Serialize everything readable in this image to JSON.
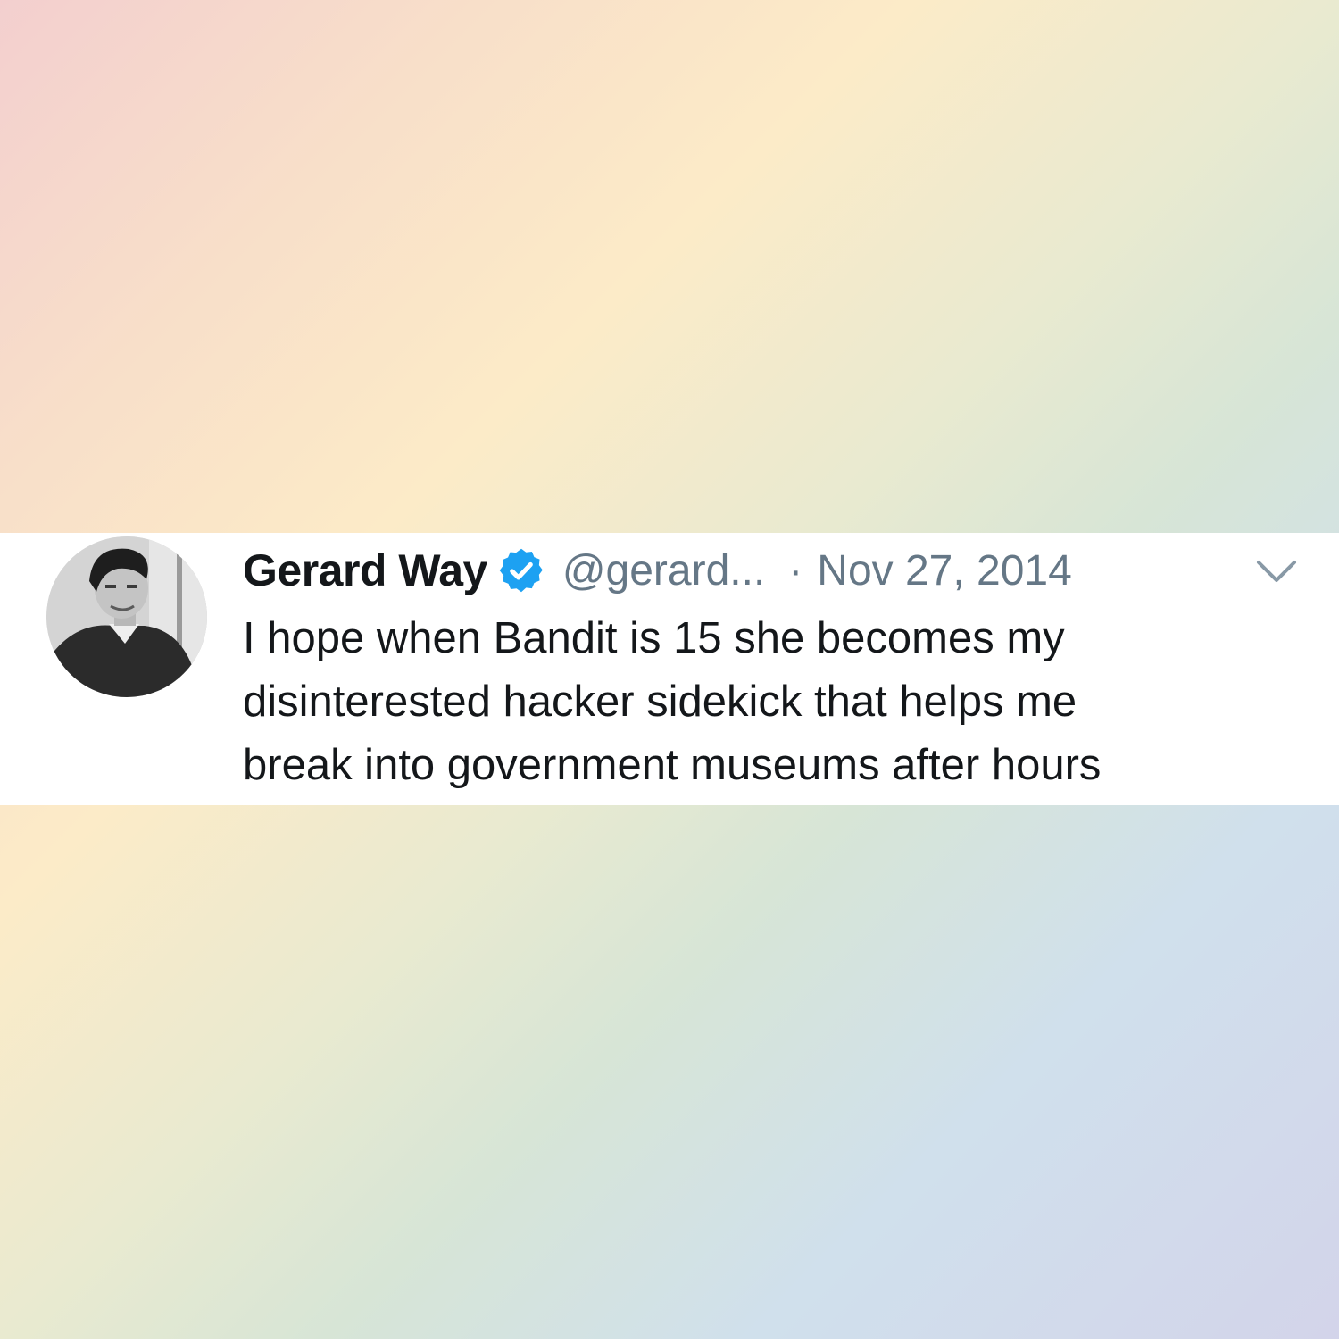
{
  "tweet": {
    "display_name": "Gerard Way",
    "verified": true,
    "handle": "@gerard...",
    "separator": "·",
    "date": "Nov 27, 2014",
    "text": "I hope when Bandit is 15 she becomes my\ndisinterested hacker sidekick that helps me\nbreak into government museums after hours"
  },
  "icons": {
    "avatar": "profile-photo",
    "badge": "verified-badge-icon",
    "menu": "chevron-down-icon"
  },
  "colors": {
    "verified_blue": "#1da1f2",
    "name_text": "#14171a",
    "meta_text": "#657786",
    "card_background": "#ffffff"
  }
}
